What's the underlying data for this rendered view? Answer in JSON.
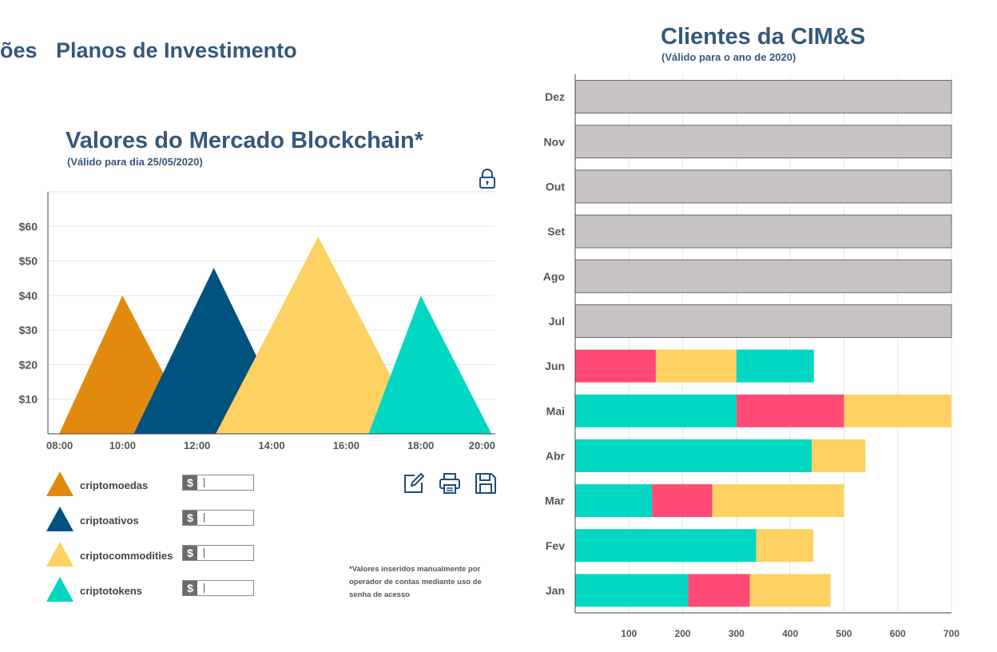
{
  "nav": {
    "tab_partial": "ões",
    "tab_active": "Planos de Investimento"
  },
  "left_chart": {
    "title": "Valores do Mercado Blockchain*",
    "subtitle": "(Válido para dia 25/05/2020)",
    "footnote": "*Valores inseridos manualmente por operador de contas mediante uso de senha de acesso",
    "icons": {
      "lock": "lock-icon",
      "edit": "edit-icon",
      "print": "print-icon",
      "save": "save-icon"
    },
    "legend": [
      {
        "label": "criptomoedas",
        "currency": "$",
        "value": "",
        "color": "#E28A0E"
      },
      {
        "label": "criptoativos",
        "currency": "$",
        "value": "",
        "color": "#00527F"
      },
      {
        "label": "criptocommodities",
        "currency": "$",
        "value": "",
        "color": "#FDD262"
      },
      {
        "label": "criptotokens",
        "currency": "$",
        "value": "",
        "color": "#00D8C3"
      }
    ]
  },
  "right_chart": {
    "title": "Clientes da CIM&S",
    "subtitle": "(Válido para o ano de 2020)"
  },
  "chart_data": [
    {
      "type": "area",
      "title": "Valores do Mercado Blockchain*",
      "subtitle": "(Válido para dia 25/05/2020)",
      "x_ticks": [
        "08:00",
        "10:00",
        "12:00",
        "14:00",
        "16:00",
        "18:00",
        "20:00"
      ],
      "y_ticks": [
        "$10",
        "$20",
        "$30",
        "$40",
        "$50",
        "$60"
      ],
      "y_tick_values": [
        10,
        20,
        30,
        40,
        50,
        60
      ],
      "xlim": [
        8,
        20
      ],
      "ylim": [
        0,
        70
      ],
      "grid": true,
      "series": [
        {
          "name": "criptomoedas",
          "color": "#E28A0E",
          "start": 8.3,
          "peak": 10.0,
          "end": 11.95,
          "value": 40
        },
        {
          "name": "criptoativos",
          "color": "#00527F",
          "start": 10.3,
          "peak": 12.45,
          "end": 14.6,
          "value": 48
        },
        {
          "name": "criptocommodities",
          "color": "#FDD262",
          "start": 12.5,
          "peak": 15.25,
          "end": 18.0,
          "value": 57
        },
        {
          "name": "criptotokens",
          "color": "#00D8C3",
          "start": 16.6,
          "peak": 18.0,
          "end": 19.9,
          "value": 40
        }
      ]
    },
    {
      "type": "bar",
      "orientation": "horizontal",
      "stacked": true,
      "title": "Clientes da CIM&S",
      "subtitle": "(Válido para o ano de 2020)",
      "categories": [
        "Jan",
        "Fev",
        "Mar",
        "Abr",
        "Mai",
        "Jun",
        "Jul",
        "Ago",
        "Set",
        "Out",
        "Nov",
        "Dez"
      ],
      "x_ticks": [
        100,
        200,
        300,
        400,
        500,
        600,
        700
      ],
      "xlim": [
        0,
        700
      ],
      "grid": true,
      "series": [
        {
          "color": "#00D8C3",
          "values": [
            210,
            337,
            143,
            440,
            300,
            0,
            0,
            0,
            0,
            0,
            0,
            0
          ]
        },
        {
          "color": "#FF4A75",
          "values": [
            115,
            0,
            112,
            0,
            200,
            150,
            0,
            0,
            0,
            0,
            0,
            0
          ]
        },
        {
          "color": "#FDD262",
          "values": [
            150,
            106,
            245,
            100,
            200,
            150,
            0,
            0,
            0,
            0,
            0,
            0
          ]
        },
        {
          "color": "#00D8C3",
          "values": [
            0,
            0,
            0,
            0,
            0,
            144,
            0,
            0,
            0,
            0,
            0,
            0
          ]
        },
        {
          "color": "#C8C4C4",
          "values": [
            0,
            0,
            0,
            0,
            0,
            0,
            700,
            700,
            700,
            700,
            700,
            700
          ]
        }
      ]
    }
  ]
}
